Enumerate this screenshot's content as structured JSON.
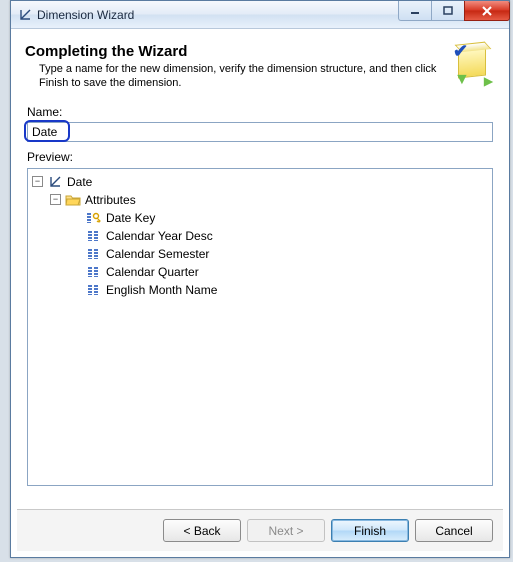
{
  "window": {
    "title": "Dimension Wizard"
  },
  "header": {
    "title": "Completing the Wizard",
    "description": "Type a name for the new dimension, verify the dimension structure, and then click Finish to save the dimension."
  },
  "nameField": {
    "label": "Name:",
    "value": "Date"
  },
  "previewLabel": "Preview:",
  "tree": {
    "root": "Date",
    "attributesLabel": "Attributes",
    "attributes": [
      "Date Key",
      "Calendar Year Desc",
      "Calendar Semester",
      "Calendar Quarter",
      "English Month Name"
    ]
  },
  "buttons": {
    "back": "< Back",
    "next": "Next >",
    "finish": "Finish",
    "cancel": "Cancel"
  }
}
